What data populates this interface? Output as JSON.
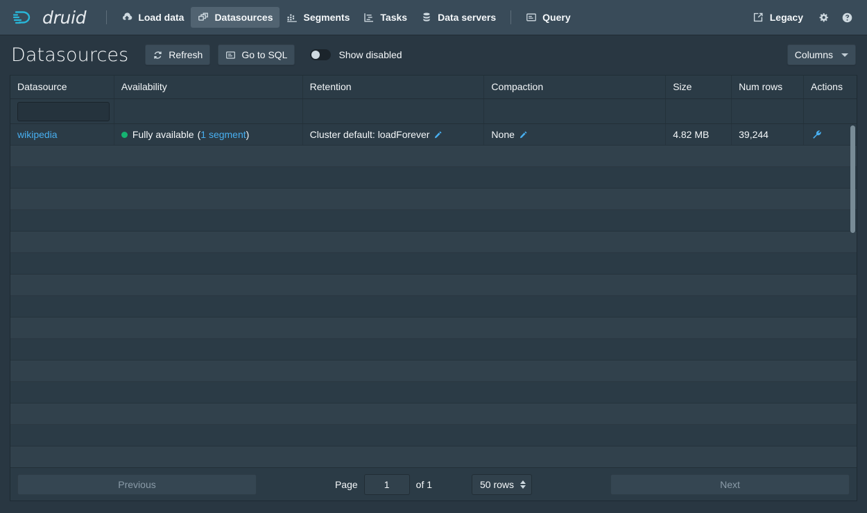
{
  "navbar": {
    "brand": "druid",
    "brand_icon": "druid-logo-icon",
    "items": [
      {
        "label": "Load data",
        "icon": "cloud-upload-icon",
        "active": false
      },
      {
        "label": "Datasources",
        "icon": "multi-select-icon",
        "active": true
      },
      {
        "label": "Segments",
        "icon": "stacked-chart-icon",
        "active": false
      },
      {
        "label": "Tasks",
        "icon": "gantt-chart-icon",
        "active": false
      },
      {
        "label": "Data servers",
        "icon": "database-icon",
        "active": false
      },
      {
        "label": "Query",
        "icon": "application-icon",
        "active": false
      }
    ],
    "right": {
      "legacy_label": "Legacy",
      "legacy_icon": "share-external-link-icon",
      "settings_icon": "gear-icon",
      "help_icon": "help-circle-icon"
    }
  },
  "toolbar": {
    "title": "Datasources",
    "refresh_label": "Refresh",
    "refresh_icon": "refresh-icon",
    "go_to_sql_label": "Go to SQL",
    "go_to_sql_icon": "application-icon",
    "show_disabled_label": "Show disabled",
    "show_disabled_on": false,
    "columns_label": "Columns",
    "columns_icon": "chevron-down-icon"
  },
  "table": {
    "columns": [
      {
        "key": "datasource",
        "label": "Datasource"
      },
      {
        "key": "availability",
        "label": "Availability"
      },
      {
        "key": "retention",
        "label": "Retention"
      },
      {
        "key": "compaction",
        "label": "Compaction"
      },
      {
        "key": "size",
        "label": "Size"
      },
      {
        "key": "numrows",
        "label": "Num rows"
      },
      {
        "key": "actions",
        "label": "Actions"
      }
    ],
    "filter": {
      "value": "",
      "placeholder": ""
    },
    "rows": [
      {
        "datasource": "wikipedia",
        "availability_status": "Fully available",
        "availability_open_paren": "(",
        "availability_segments": "1 segment",
        "availability_close_paren": ")",
        "availability_dot_color": "#15b371",
        "retention": "Cluster default: loadForever",
        "compaction": "None",
        "size": "4.82 MB",
        "numrows": "39,244",
        "action_icon": "wrench-icon",
        "edit_icon": "pencil-icon"
      }
    ],
    "empty_row_count": 16
  },
  "pagination": {
    "previous_label": "Previous",
    "next_label": "Next",
    "page_word": "Page",
    "page_value": "1",
    "of_text": "of 1",
    "rows_per_page": "50 rows",
    "stepper_icon": "double-caret-vertical-icon"
  }
}
